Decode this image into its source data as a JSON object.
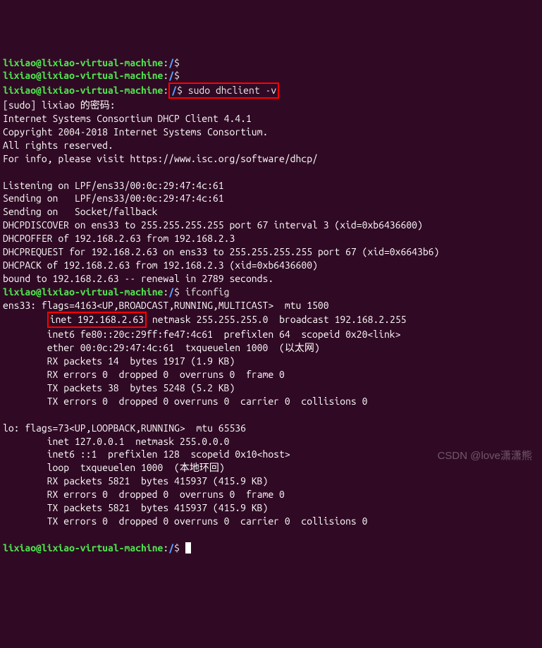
{
  "prompt": {
    "user": "lixiao",
    "host": "lixiao-virtual-machine",
    "path": "/",
    "symbol": "$"
  },
  "lines": {
    "cmd_empty1": "",
    "cmd_empty2": "",
    "cmd_sudo": "sudo dhclient -v",
    "sudo_pw": "[sudo] lixiao 的密码:",
    "isc1": "Internet Systems Consortium DHCP Client 4.4.1",
    "isc2": "Copyright 2004-2018 Internet Systems Consortium.",
    "isc3": "All rights reserved.",
    "isc4": "For info, please visit https://www.isc.org/software/dhcp/",
    "blank": "",
    "listen": "Listening on LPF/ens33/00:0c:29:47:4c:61",
    "send1": "Sending on   LPF/ens33/00:0c:29:47:4c:61",
    "send2": "Sending on   Socket/fallback",
    "disc": "DHCPDISCOVER on ens33 to 255.255.255.255 port 67 interval 3 (xid=0xb6436600)",
    "offer": "DHCPOFFER of 192.168.2.63 from 192.168.2.3",
    "req": "DHCPREQUEST for 192.168.2.63 on ens33 to 255.255.255.255 port 67 (xid=0x6643b6)",
    "ack": "DHCPACK of 192.168.2.63 from 192.168.2.3 (xid=0xb6436600)",
    "bound": "bound to 192.168.2.63 -- renewal in 2789 seconds.",
    "cmd_ifconfig": "ifconfig",
    "ens33_hdr": "ens33: flags=4163<UP,BROADCAST,RUNNING,MULTICAST>  mtu 1500",
    "inet_box": "inet 192.168.2.63",
    "inet_rest": " netmask 255.255.255.0  broadcast 192.168.2.255",
    "inet6": "        inet6 fe80::20c:29ff:fe47:4c61  prefixlen 64  scopeid 0x20<link>",
    "ether": "        ether 00:0c:29:47:4c:61  txqueuelen 1000  (以太网)",
    "rxp": "        RX packets 14  bytes 1917 (1.9 KB)",
    "rxe": "        RX errors 0  dropped 0  overruns 0  frame 0",
    "txp": "        TX packets 38  bytes 5248 (5.2 KB)",
    "txe": "        TX errors 0  dropped 0 overruns 0  carrier 0  collisions 0",
    "lo_hdr": "lo: flags=73<UP,LOOPBACK,RUNNING>  mtu 65536",
    "lo_inet": "        inet 127.0.0.1  netmask 255.0.0.0",
    "lo_inet6": "        inet6 ::1  prefixlen 128  scopeid 0x10<host>",
    "lo_loop": "        loop  txqueuelen 1000  (本地环回)",
    "lo_rxp": "        RX packets 5821  bytes 415937 (415.9 KB)",
    "lo_rxe": "        RX errors 0  dropped 0  overruns 0  frame 0",
    "lo_txp": "        TX packets 5821  bytes 415937 (415.9 KB)",
    "lo_txe": "        TX errors 0  dropped 0 overruns 0  carrier 0  collisions 0"
  },
  "watermark": "CSDN @love潇潇熊"
}
